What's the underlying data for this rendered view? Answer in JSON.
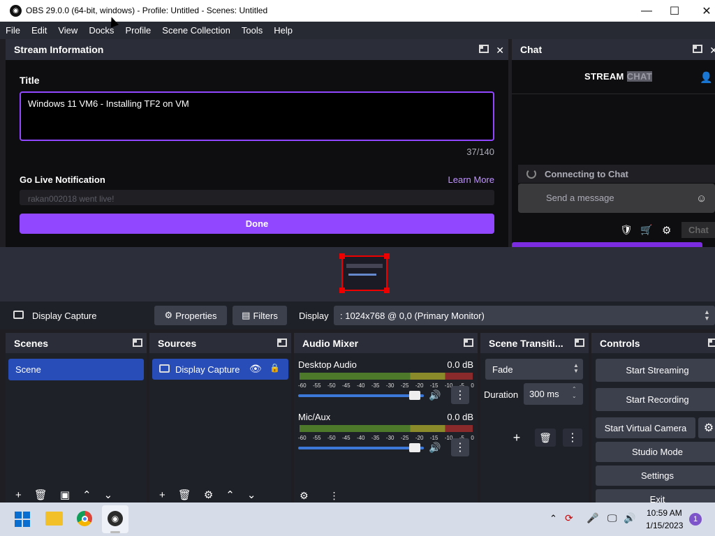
{
  "window": {
    "title": "OBS 29.0.0 (64-bit, windows) - Profile: Untitled - Scenes: Untitled"
  },
  "menu": [
    "File",
    "Edit",
    "View",
    "Docks",
    "Profile",
    "Scene Collection",
    "Tools",
    "Help"
  ],
  "stream_info": {
    "header": "Stream Information",
    "title_label": "Title",
    "title_value": "Windows 11 VM6 - Installing TF2 on VM",
    "char_count": "37/140",
    "golive_label": "Go Live Notification",
    "learn_more": "Learn More",
    "golive_value": "rakan002018 went live!",
    "done": "Done"
  },
  "chat": {
    "header": "Chat",
    "title_a": "STREAM",
    "title_b": "CHAT",
    "connecting": "Connecting to Chat",
    "send_placeholder": "Send a message",
    "chat_button": "Chat"
  },
  "source_bar": {
    "source_name": "Display Capture",
    "properties": "Properties",
    "filters": "Filters",
    "display_label": "Display",
    "display_value": ": 1024x768 @ 0,0 (Primary Monitor)"
  },
  "scenes": {
    "header": "Scenes",
    "items": [
      "Scene"
    ]
  },
  "sources": {
    "header": "Sources",
    "items": [
      "Display Capture"
    ]
  },
  "mixer": {
    "header": "Audio Mixer",
    "ticks": [
      "-60",
      "-55",
      "-50",
      "-45",
      "-40",
      "-35",
      "-30",
      "-25",
      "-20",
      "-15",
      "-10",
      "-5",
      "0"
    ],
    "channels": [
      {
        "name": "Desktop Audio",
        "db": "0.0 dB",
        "volume": 0.96
      },
      {
        "name": "Mic/Aux",
        "db": "0.0 dB",
        "volume": 0.96
      }
    ]
  },
  "transitions": {
    "header": "Scene Transiti...",
    "selected": "Fade",
    "duration_label": "Duration",
    "duration_value": "300 ms"
  },
  "controls": {
    "header": "Controls",
    "start_streaming": "Start Streaming",
    "start_recording": "Start Recording",
    "start_virtual": "Start Virtual Camera",
    "studio_mode": "Studio Mode",
    "settings": "Settings",
    "exit": "Exit"
  },
  "taskbar": {
    "time": "10:59 AM",
    "date": "1/15/2023",
    "notifications": "1"
  },
  "colors": {
    "accent": "#9147ff",
    "selected": "#284cb8",
    "titlebar": "#ffffff",
    "panel": "#2b2e38"
  }
}
